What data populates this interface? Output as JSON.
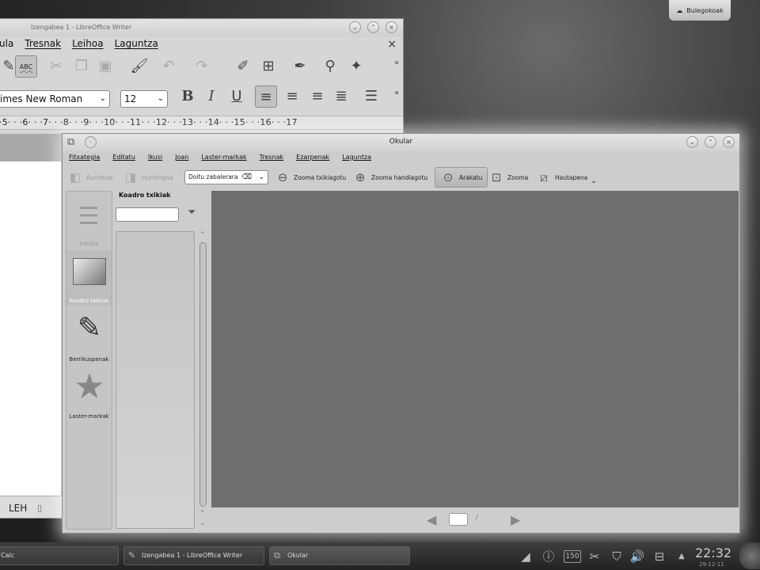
{
  "desktop": {
    "button_label": "Bulegokoak"
  },
  "writer": {
    "title": "Izengabea 1 - LibreOffice Writer",
    "menu": [
      "ula",
      "Tresnak",
      "Leihoa",
      "Laguntza"
    ],
    "close_glyph": "×",
    "font_name": "imes New Roman",
    "font_size": "12",
    "spell_label": "ABC",
    "ruler_text": "·5· · ·6· · ·7· · ·8· · ·9· · ·10· · ·11· · ·12· · ·13· · ·14· · ·15· · ·16· · ·17",
    "status_lang": "LEH"
  },
  "okular": {
    "title": "Okular",
    "menu": [
      "Fitxategia",
      "Editatu",
      "Ikusi",
      "Joan",
      "Laster-markak",
      "Tresnak",
      "Ezarpenak",
      "Laguntza"
    ],
    "toolbar": {
      "back": "Aurrekoa",
      "forward": "Hurrengoa",
      "zoom_select": "Doitu zabalerara",
      "zoom_out": "Zooma txikiagotu",
      "zoom_in": "Zooma handiagotu",
      "browse": "Arakatu",
      "zoom": "Zooma",
      "selection": "Hautapena"
    },
    "sidebar": [
      {
        "label": "Edukia",
        "icon": "contents-icon",
        "enabled": false
      },
      {
        "label": "Koadro txikiak",
        "icon": "thumbnails-icon",
        "active": true
      },
      {
        "label": "Berrikuspenak",
        "icon": "pen-icon"
      },
      {
        "label": "Laster-markak",
        "icon": "star-icon"
      }
    ],
    "panel_title": "Koadro txikiak",
    "page_separator": "/"
  },
  "taskbar": {
    "tasks": [
      "Calc",
      "Izengabea 1 - LibreOffice Writer",
      "Okular"
    ],
    "clock": "22:32",
    "date": "29-12-11"
  }
}
